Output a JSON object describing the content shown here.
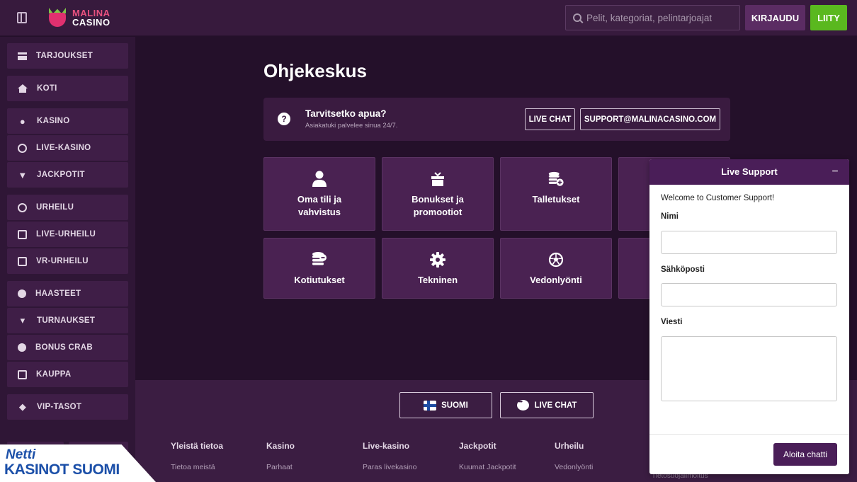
{
  "header": {
    "logo_line1": "MALINA",
    "logo_line2": "CASINO",
    "search_placeholder": "Pelit, kategoriat, pelintarjoajat",
    "login_label": "KIRJAUDU",
    "join_label": "LIITY"
  },
  "sidebar": {
    "items": [
      {
        "label": "TARJOUKSET",
        "icon": "gift-icon"
      },
      {
        "label": "KOTI",
        "icon": "home-icon"
      },
      {
        "label": "KASINO",
        "icon": "cherries-icon"
      },
      {
        "label": "LIVE-KASINO",
        "icon": "chip-icon"
      },
      {
        "label": "JACKPOTIT",
        "icon": "fox-icon"
      },
      {
        "label": "URHEILU",
        "icon": "football-icon"
      },
      {
        "label": "LIVE-URHEILU",
        "icon": "live-play-icon"
      },
      {
        "label": "VR-URHEILU",
        "icon": "vr-icon"
      },
      {
        "label": "HAASTEET",
        "icon": "medal-icon"
      },
      {
        "label": "TURNAUKSET",
        "icon": "trophy-icon"
      },
      {
        "label": "BONUS CRAB",
        "icon": "claw-icon"
      },
      {
        "label": "KAUPPA",
        "icon": "shop-icon"
      },
      {
        "label": "VIP-TASOT",
        "icon": "diamond-icon"
      }
    ]
  },
  "main": {
    "title": "Ohjekeskus",
    "help": {
      "title": "Tarvitsetko apua?",
      "subtitle": "Asiakatuki palvelee sinua 24/7.",
      "live_chat": "LIVE CHAT",
      "email": "SUPPORT@MALINACASINO.COM"
    },
    "tiles": [
      {
        "label": "Oma tili ja\nvahvistus",
        "icon": "user-icon"
      },
      {
        "label": "Bonukset ja\npromootiot",
        "icon": "gift-icon"
      },
      {
        "label": "Talletukset",
        "icon": "coins-plus-icon"
      },
      {
        "label": "Kotiutukset",
        "icon": "coins-minus-icon"
      },
      {
        "label": "Tekninen",
        "icon": "gear-icon"
      },
      {
        "label": "Vedonlyönti",
        "icon": "football-icon"
      }
    ]
  },
  "footer": {
    "language_label": "SUOMI",
    "live_chat_label": "LIVE CHAT",
    "columns": [
      {
        "title": "Yleistä tietoa",
        "link": "Tietoa meistä"
      },
      {
        "title": "Kasino",
        "link": "Parhaat"
      },
      {
        "title": "Live-kasino",
        "link": "Paras livekasino"
      },
      {
        "title": "Jackpotit",
        "link": "Kuumat Jackpotit"
      },
      {
        "title": "Urheilu",
        "link": "Vedonlyönti"
      }
    ],
    "peek_link": "Tietosuojailmoitus"
  },
  "watermark": {
    "line1": "Netti",
    "line2": "KASINOT SUOMI"
  },
  "live_support": {
    "title": "Live Support",
    "minimize": "−",
    "welcome": "Welcome to Customer Support!",
    "name_label": "Nimi",
    "email_label": "Sähköposti",
    "message_label": "Viesti",
    "start_button": "Aloita chatti"
  },
  "colors": {
    "brand_purple": "#4a1e58",
    "join_green": "#5ab81f",
    "logo_pink": "#e8517f"
  }
}
